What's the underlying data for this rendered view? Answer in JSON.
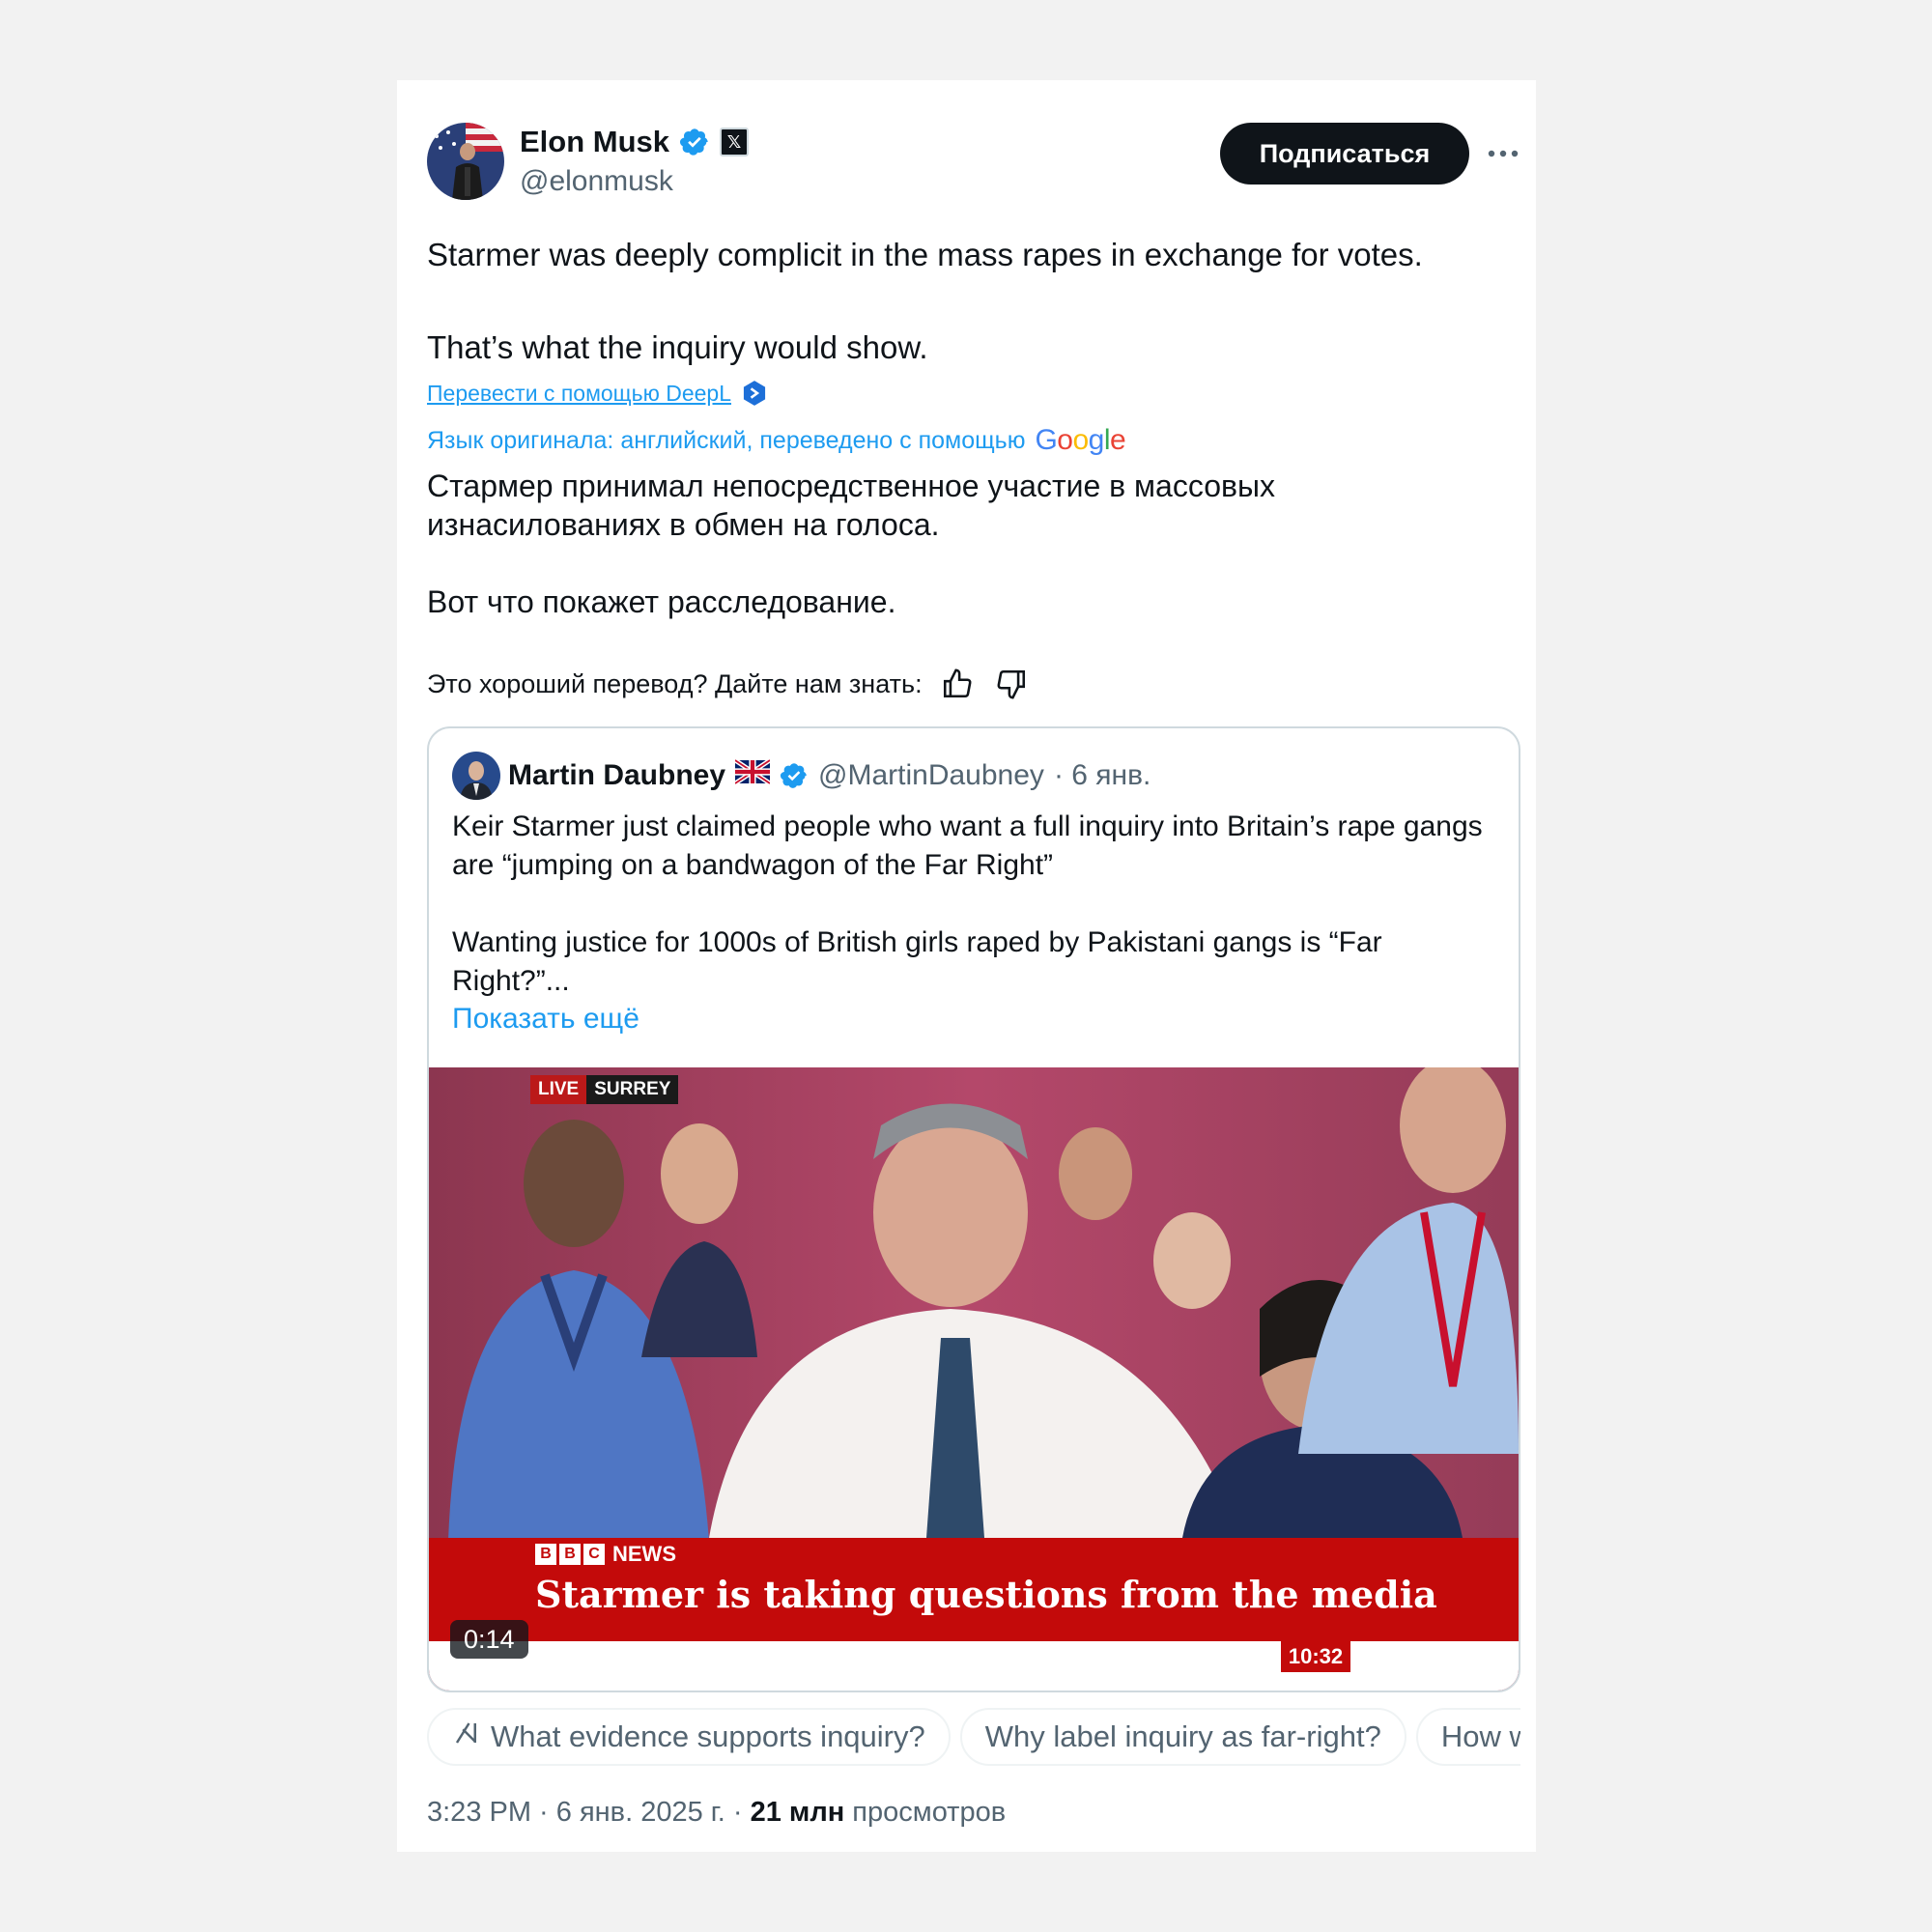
{
  "author": {
    "name": "Elon Musk",
    "handle": "@elonmusk"
  },
  "follow_label": "Подписаться",
  "tweet_text": "Starmer was deeply complicit in the mass rapes in exchange for votes.\n\nThat’s what the inquiry would show.",
  "translate_deepl_label": "Перевести с помощью DeepL",
  "original_language_label": "Язык оригинала: английский, переведено с помощью",
  "google_label": "Google",
  "translated_text": "Стармер принимал непосредственное участие в массовых изнасилованиях в обмен на голоса.\n\nВот что покажет расследование.",
  "feedback_label": "Это хороший перевод? Дайте нам знать:",
  "quote": {
    "name": "Martin Daubney",
    "handle": "@MartinDaubney",
    "date": "· 6 янв.",
    "text": "Keir Starmer just claimed people who want a full inquiry into Britain’s rape gangs are “jumping on a bandwagon of the Far Right”\n\nWanting justice for 1000s of British girls raped by Pakistani gangs is “Far Right?”...",
    "show_more": "Показать ещё",
    "video": {
      "live_label": "LIVE",
      "location_label": "SURREY",
      "channel": "NEWS",
      "headline": "Starmer is taking questions from the media",
      "clock": "10:32",
      "duration": "0:14"
    }
  },
  "grok_chips": [
    "What evidence supports inquiry?",
    "Why label inquiry as far-right?",
    "How w"
  ],
  "meta": {
    "time_date": "3:23 PM · 6 янв. 2025 г. ·",
    "views_count": "21 млн",
    "views_label": "просмотров"
  },
  "colors": {
    "accent": "#1d9bf0",
    "text": "#0f1419",
    "secondary": "#536471",
    "bbc_red": "#c30a0a"
  }
}
